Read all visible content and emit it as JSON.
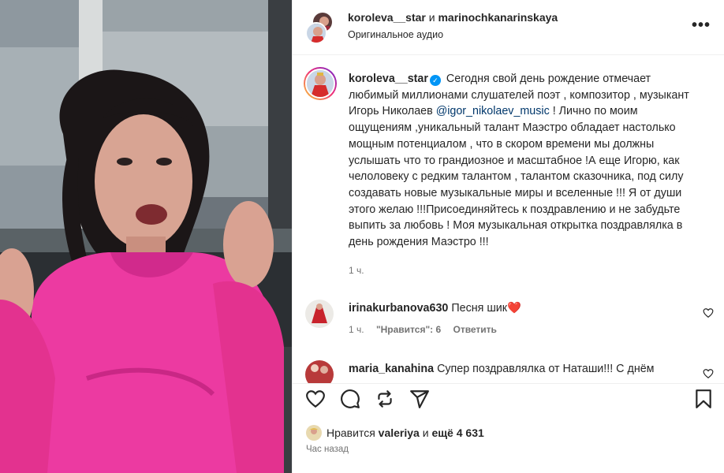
{
  "header": {
    "user1": "koroleva__star",
    "conj": "и",
    "user2": "marinochkanarinskaya",
    "audio": "Оригинальное аудио",
    "more_icon": "more-horizontal-icon"
  },
  "caption": {
    "username": "koroleva__star",
    "verified_icon": "verified-badge-icon",
    "text_part1": "Сегодня свой день рождение отмечает любимый миллионами слушателей поэт , композитор , музыкант Игорь Николаев",
    "mention": "@igor_nikolaev_music",
    "text_part2": "! Лично по моим ощущениям ,уникальный талант Маэстро обладает настолько мощным потенциалом , что в скором времени мы должны услышать что то грандиозное и масштабное !А еще Игорю, как челоловеку с редким талантом , талантом сказочника, под силу создавать новые музыкальные миры и вселенные !!! Я от души этого желаю !!!Присоединяйтесь к поздравлению и не забудьте выпить за любовь ! Моя музыкальная открытка поздравлялка в день рождения Маэстро !!!",
    "time": "1 ч."
  },
  "comments": [
    {
      "username": "irinakurbanova630",
      "text": "Песня шик",
      "emoji": "❤️",
      "time": "1 ч.",
      "likes": "\"Нравится\": 6",
      "reply": "Ответить"
    },
    {
      "username": "maria_kanahina",
      "text": "Супер поздравлялка от Наташи!!! С днём"
    }
  ],
  "actions": {
    "icons": [
      "heart-icon",
      "comment-icon",
      "repost-icon",
      "share-icon",
      "bookmark-icon"
    ],
    "likes_prefix": "Нравится",
    "likes_user": "valeriya",
    "likes_and": "и",
    "likes_count": "ещё 4 631",
    "posted": "Час назад"
  }
}
